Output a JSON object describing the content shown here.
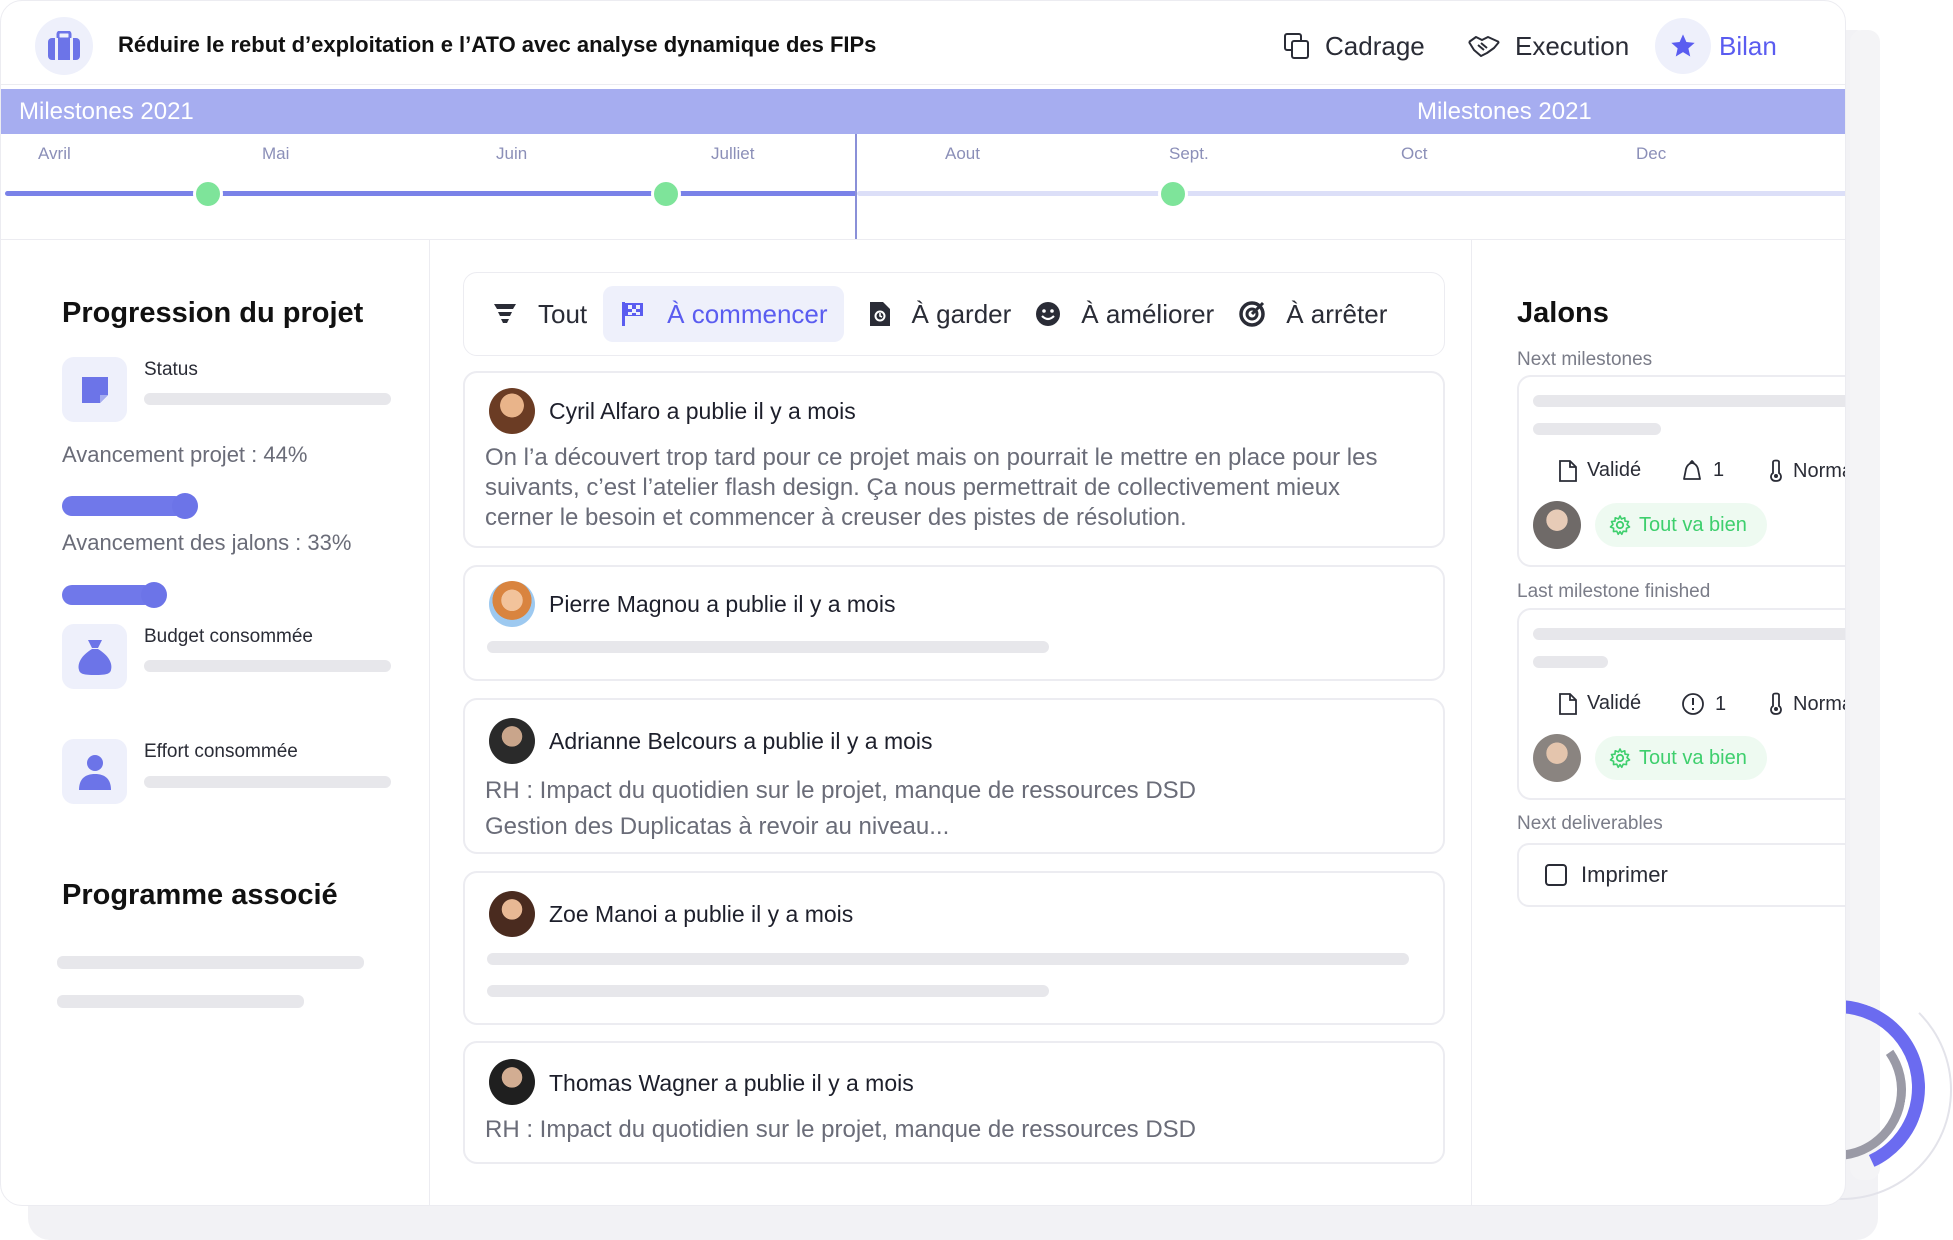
{
  "header": {
    "title": "Réduire le rebut d’exploitation e l’ATO avec analyse dynamique des FIPs",
    "logo_icon": "briefcase-icon",
    "nav": [
      {
        "label": "Cadrage",
        "icon": "copy-icon"
      },
      {
        "label": "Execution",
        "icon": "handshake-icon"
      },
      {
        "label": "Bilan",
        "icon": "star-icon"
      }
    ]
  },
  "timeline": {
    "banner_left": "Milestones 2021",
    "banner_right": "Milestones 2021",
    "months": [
      "Avril",
      "Mai",
      "Juin",
      "Julliet",
      "Aout",
      "Sept.",
      "Oct",
      "Dec"
    ]
  },
  "progress": {
    "title": "Progression du projet",
    "status_label": "Status",
    "avancement_projet": "Avancement projet : 44%",
    "avancement_projet_value": 0.44,
    "avancement_jalons": "Avancement des jalons : 33%",
    "avancement_jalons_value": 0.33,
    "budget_label": "Budget consommée",
    "effort_label": "Effort consommée",
    "programme_title": "Programme associé"
  },
  "tabs": [
    {
      "label": "Tout",
      "icon": "filter-icon"
    },
    {
      "label": "À commencer",
      "icon": "flag-icon",
      "active": true
    },
    {
      "label": "À garder",
      "icon": "document-icon"
    },
    {
      "label": "À améliorer",
      "icon": "smile-icon"
    },
    {
      "label": "À arrêter",
      "icon": "target-icon"
    }
  ],
  "posts": [
    {
      "author": "Cyril Alfaro a publie il y a mois",
      "lines": [
        "On l’a découvert trop tard pour ce projet mais on pourrait le mettre en place pour les",
        "suivants, c’est l’atelier flash design. Ça nous permettrait de collectivement mieux",
        "cerner le besoin et commencer à creuser des pistes de résolution."
      ]
    },
    {
      "author": "Pierre Magnou  a publie il y a mois",
      "lines": []
    },
    {
      "author": "Adrianne Belcours a publie il y a mois",
      "lines": [
        "RH : Impact du quotidien sur le projet, manque de ressources DSD",
        "Gestion des Duplicatas à revoir au niveau..."
      ]
    },
    {
      "author": "Zoe Manoi a publie il y a mois",
      "lines": []
    },
    {
      "author": "Thomas Wagner a publie il y a mois",
      "lines": [
        "RH : Impact du quotidien sur le projet, manque de ressources DSD"
      ]
    }
  ],
  "jalons": {
    "title": "Jalons",
    "next_label": "Next milestones",
    "last_label": "Last milestone finished",
    "deliv_label": "Next deliverables",
    "next": {
      "valide": "Validé",
      "count": "1",
      "prio": "Normal",
      "badge": "Tout va bien"
    },
    "last": {
      "valide": "Validé",
      "count": "1",
      "prio": "Normal",
      "badge": "Tout va bien"
    },
    "deliverable": "Imprimer"
  },
  "colors": {
    "accent": "#5a5cf0",
    "timeline": "#a6adf0",
    "milestone": "#7ee49a",
    "ok": "#3ecf6d"
  }
}
